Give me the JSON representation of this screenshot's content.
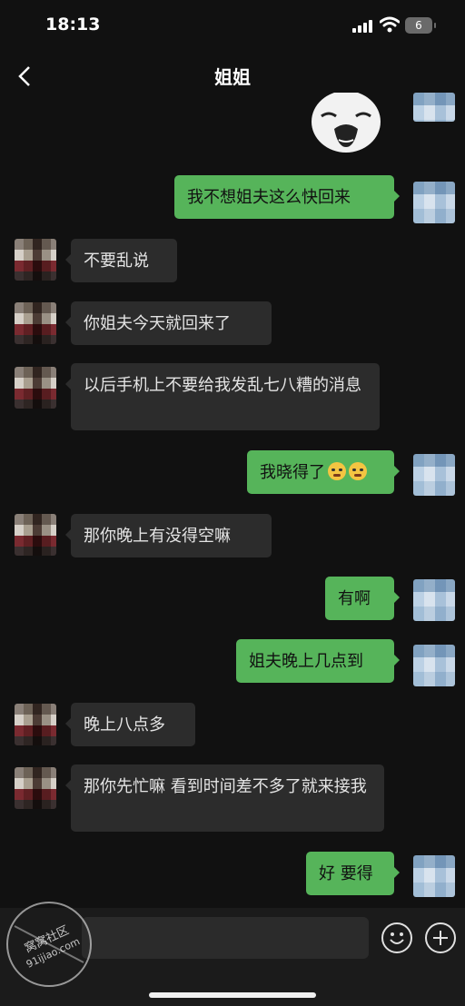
{
  "status_bar": {
    "time": "18:13",
    "battery": "6"
  },
  "nav": {
    "title": "姐姐"
  },
  "messages": [
    {
      "side": "right",
      "text": "我不想姐夫这么快回来"
    },
    {
      "side": "left",
      "text": "不要乱说"
    },
    {
      "side": "left",
      "text": "你姐夫今天就回来了"
    },
    {
      "side": "left",
      "text": "以后手机上不要给我发乱七八糟的消息"
    },
    {
      "side": "right",
      "text": "我晓得了"
    },
    {
      "side": "left",
      "text": "那你晚上有没得空嘛"
    },
    {
      "side": "right",
      "text": "有啊"
    },
    {
      "side": "right",
      "text": "姐夫晚上几点到"
    },
    {
      "side": "left",
      "text": "晚上八点多"
    },
    {
      "side": "left",
      "text": "那你先忙嘛 看到时间差不多了就来接我"
    },
    {
      "side": "right",
      "text": "好 要得"
    }
  ],
  "watermark": {
    "line1": "窝窝社区",
    "line2": "91ijiao.com"
  },
  "colors": {
    "outgoing_bubble": "#56b45a",
    "incoming_bubble": "#2c2c2c",
    "background": "#111111"
  }
}
